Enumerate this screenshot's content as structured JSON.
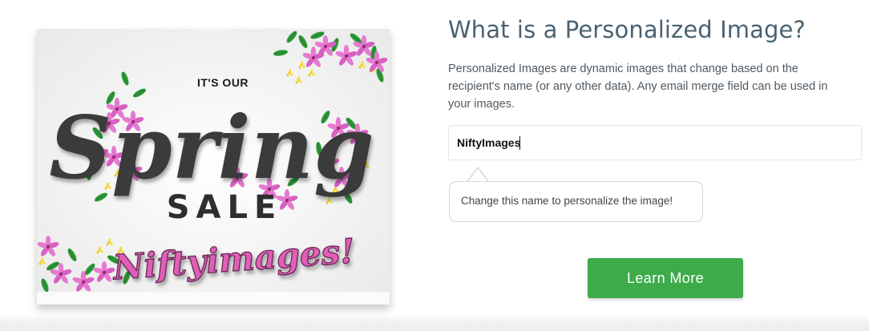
{
  "promo_image": {
    "line1": "IT'S OUR",
    "line2": "Spring",
    "line3": "SALE",
    "name": "Niftyimages!"
  },
  "content": {
    "title": "What is a Personalized Image?",
    "description": "Personalized Images are dynamic images that change based on the recipient's name (or any other data). Any email merge field can be used in your images."
  },
  "name_input": {
    "value": "NiftyImages"
  },
  "tooltip": {
    "text": "Change this name to personalize the image!"
  },
  "cta": {
    "label": "Learn More"
  },
  "colors": {
    "title": "#4a6272",
    "button": "#3eab4a",
    "spring_text": "#3a3a3a",
    "name_text": "#e060b8"
  }
}
